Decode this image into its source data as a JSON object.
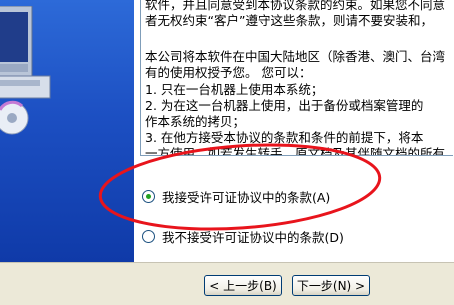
{
  "license": {
    "lines": [
      "软件，并且同意受到本协议条款的约束。如果您不同意",
      "者无权约束“客户”遵守这些条款，则请不要安装和，",
      "",
      "本公司将本软件在中国大陆地区（除香港、澳门、台湾",
      "有的使用权授予您。 您可以：",
      "  1. 只在一台机器上使用本系统；",
      "  2. 为在这一台机器上使用，出于备份或档案管理的",
      "作本系统的拷贝；",
      "  3. 在他方接受本协议的条款和条件的前提下，将本",
      "一方使用。如若发生转手，原文档及其伴随文档的所有"
    ]
  },
  "options": {
    "accept_label": "我接受许可证协议中的条款(A)",
    "decline_label": "我不接受许可证协议中的条款(D)",
    "selected": "accept"
  },
  "buttons": {
    "back_label": "< 上一步(B)",
    "next_label": "下一步(N) >"
  },
  "colors": {
    "annotation": "#e8141c",
    "radio_check": "#21a121",
    "panel_blue": "#1c4fc2"
  }
}
